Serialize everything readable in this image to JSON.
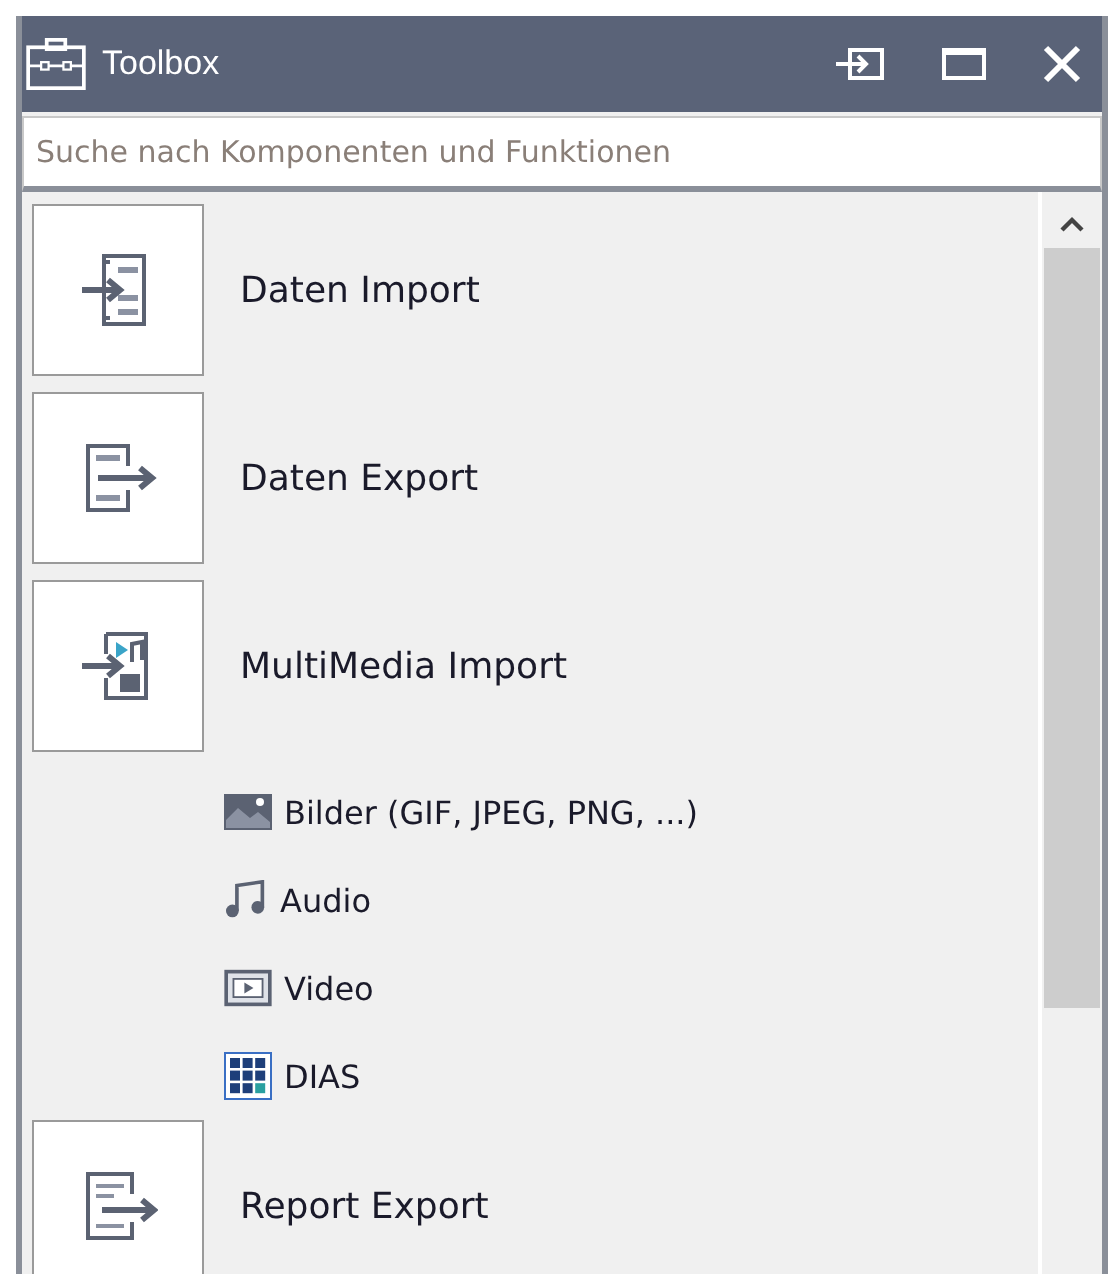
{
  "window": {
    "title": "Toolbox"
  },
  "search": {
    "placeholder": "Suche nach Komponenten und Funktionen"
  },
  "items": [
    {
      "label": "Daten Import",
      "kind": "data-import"
    },
    {
      "label": "Daten Export",
      "kind": "data-export"
    },
    {
      "label": "MultiMedia Import",
      "kind": "multimedia-import",
      "children": [
        {
          "label": "Bilder (GIF, JPEG, PNG, ...)",
          "kind": "image"
        },
        {
          "label": "Audio",
          "kind": "audio"
        },
        {
          "label": "Video",
          "kind": "video"
        },
        {
          "label": "DIAS",
          "kind": "dias"
        }
      ]
    },
    {
      "label": "Report Export",
      "kind": "report-export"
    }
  ]
}
